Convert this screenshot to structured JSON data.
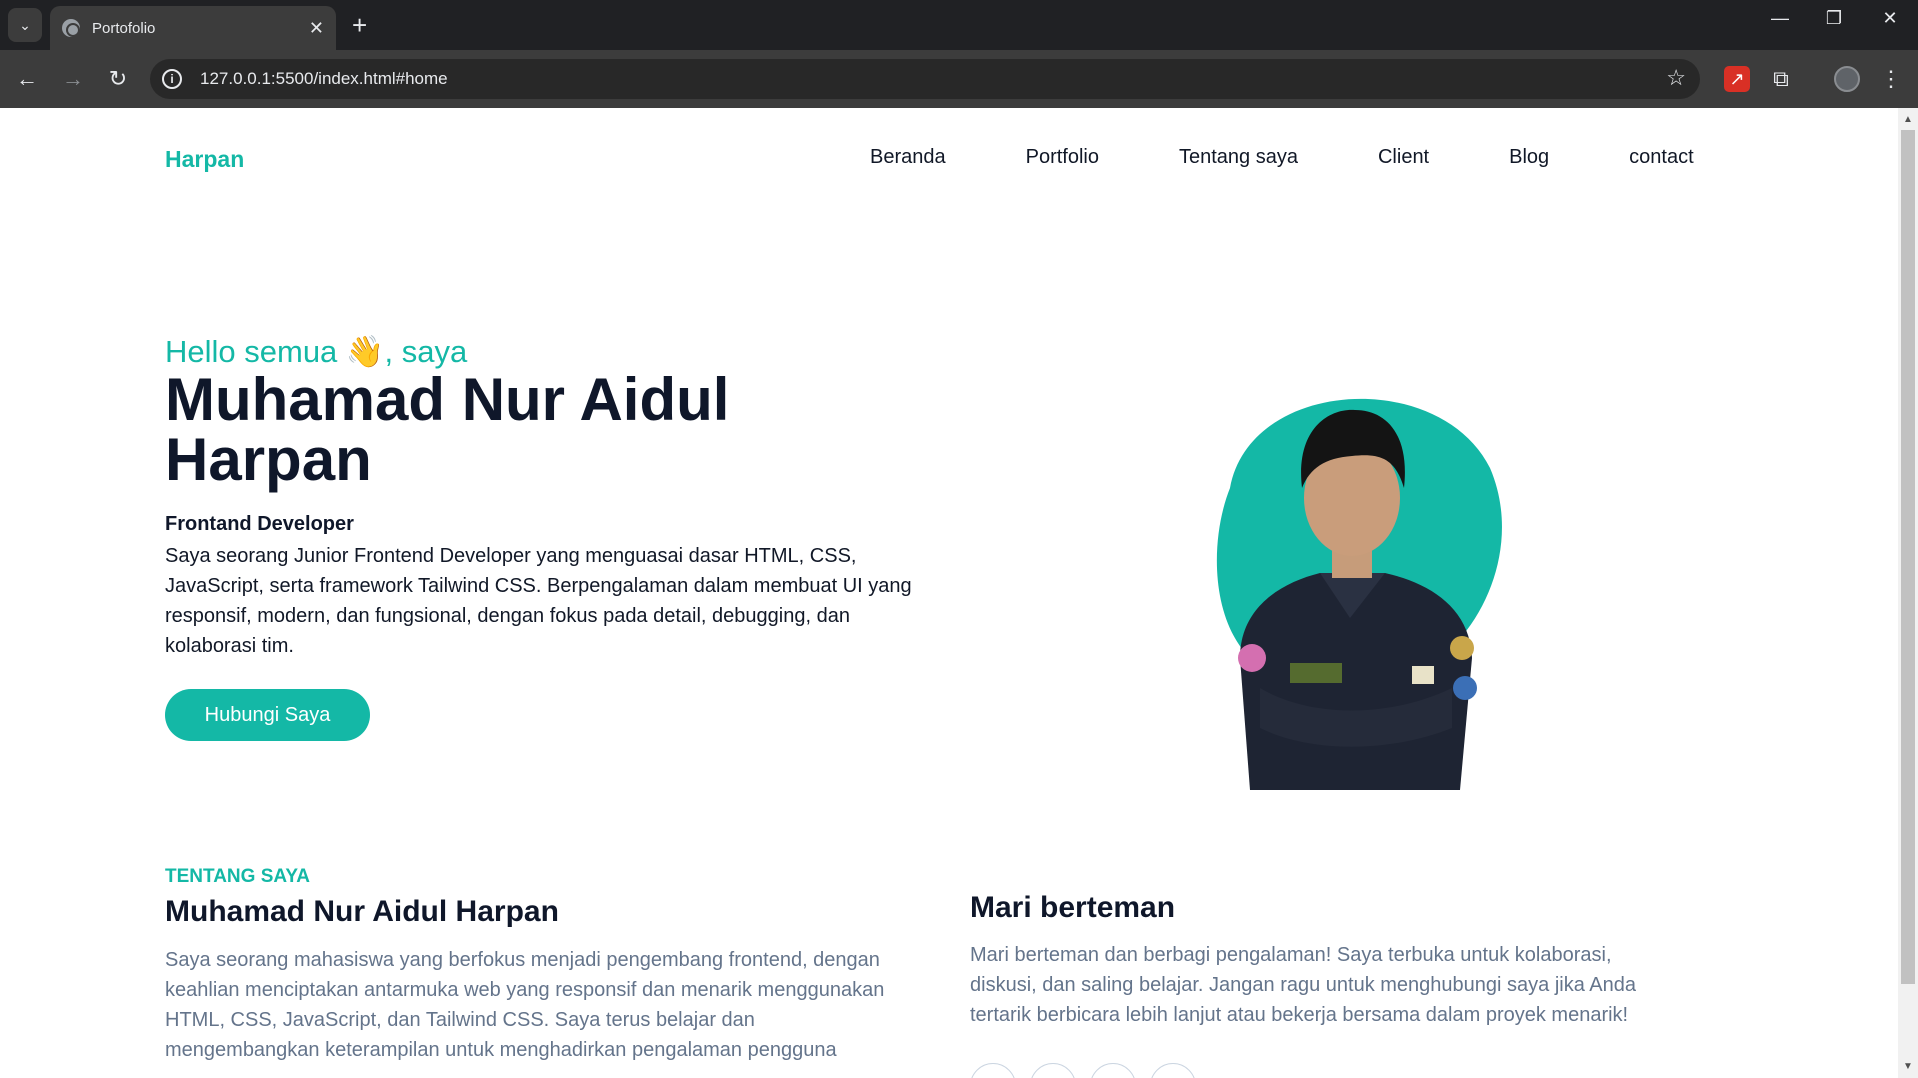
{
  "browser": {
    "tab_title": "Portofolio",
    "url": "127.0.0.1:5500/index.html#home"
  },
  "site": {
    "brand": "Harpan",
    "nav": [
      "Beranda",
      "Portfolio",
      "Tentang saya",
      "Client",
      "Blog",
      "contact"
    ]
  },
  "hero": {
    "greeting": "Hello semua 👋, saya",
    "name": "Muhamad Nur Aidul Harpan",
    "role": "Frontand Developer",
    "description": "Saya seorang Junior Frontend Developer yang menguasai dasar HTML, CSS, JavaScript, serta framework Tailwind CSS. Berpengalaman dalam membuat UI yang responsif, modern, dan fungsional, dengan fokus pada detail, debugging, dan kolaborasi tim.",
    "cta": "Hubungi Saya",
    "accent": "#14b8a6"
  },
  "about": {
    "tag": "TENTANG SAYA",
    "name": "Muhamad Nur Aidul Harpan",
    "text": "Saya seorang mahasiswa yang berfokus menjadi pengembang frontend, dengan keahlian menciptakan antarmuka web yang responsif dan menarik menggunakan HTML, CSS, JavaScript, dan Tailwind CSS. Saya terus belajar dan mengembangkan keterampilan untuk menghadirkan pengalaman pengguna"
  },
  "friends": {
    "title": "Mari berteman",
    "text": "Mari berteman dan berbagi pengalaman! Saya terbuka untuk kolaborasi, diskusi, dan saling belajar. Jangan ragu untuk menghubungi saya jika Anda tertarik berbicara lebih lanjut atau bekerja bersama dalam proyek menarik!",
    "socials": [
      "instagram-icon",
      "facebook-icon",
      "whatsapp-icon",
      "email-icon"
    ]
  }
}
